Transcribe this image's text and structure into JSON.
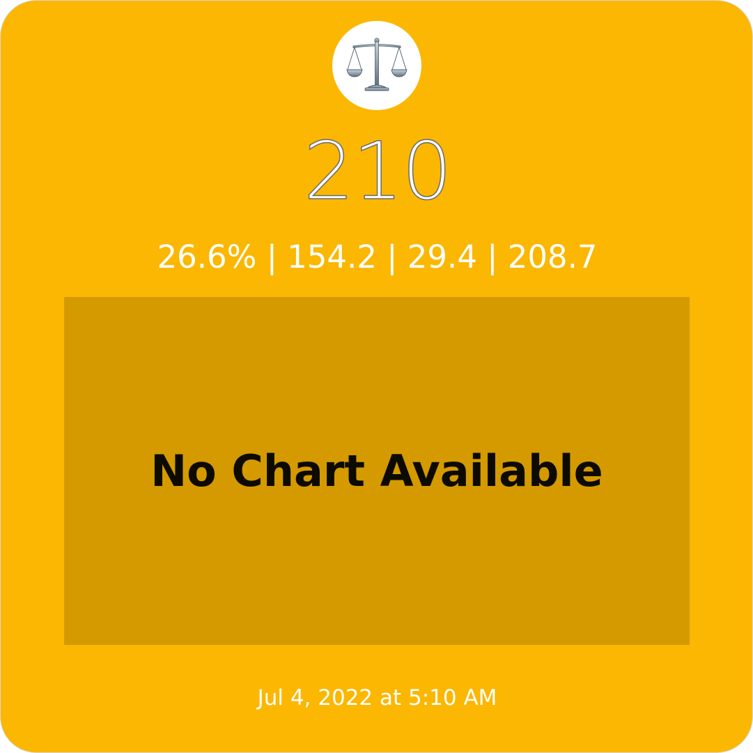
{
  "widget": {
    "background_color": "#fbb701",
    "icon": "balance-scale-icon",
    "value": "210",
    "stats": [
      "26.6%",
      "154.2",
      "29.4",
      "208.7"
    ],
    "stats_line": "26.6% | 154.2 | 29.4 | 208.7",
    "chart": {
      "message": "No Chart Available",
      "background_color": "#d49a00"
    },
    "timestamp": "Jul 4, 2022 at 5:10 AM"
  }
}
